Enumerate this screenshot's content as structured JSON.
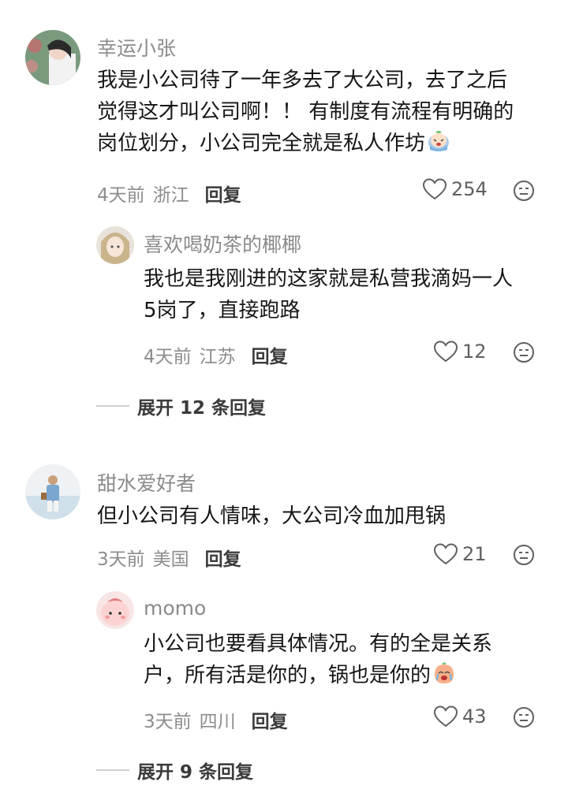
{
  "comments": [
    {
      "username": "幸运小张",
      "lines": [
        "我是小公司待了一年多去了大公司，去了之后",
        "觉得这才叫公司啊！！ 有制度有流程有明确的",
        "岗位划分，小公司完全就是私人作坊"
      ],
      "emoji": "crying-emoji",
      "time": "4天前",
      "location": "浙江",
      "reply_label": "回复",
      "likes": "254",
      "replies": [
        {
          "username": "喜欢喝奶茶的椰椰",
          "lines": [
            "我也是我刚进的这家就是私营我滴妈一人",
            "5岗了，直接跑路"
          ],
          "time": "4天前",
          "location": "江苏",
          "reply_label": "回复",
          "likes": "12"
        }
      ],
      "expand_label": "展开 12 条回复"
    },
    {
      "username": "甜水爱好者",
      "lines": [
        "但小公司有人情味，大公司冷血加甩锅"
      ],
      "time": "3天前",
      "location": "美国",
      "reply_label": "回复",
      "likes": "21",
      "replies": [
        {
          "username": "momo",
          "lines": [
            "小公司也要看具体情况。有的全是关系",
            "户，所有活是你的，锅也是你的"
          ],
          "emoji": "sobbing-peach-emoji",
          "time": "3天前",
          "location": "四川",
          "reply_label": "回复",
          "likes": "43"
        }
      ],
      "expand_label": "展开 9 条回复"
    }
  ],
  "colors": {
    "username": "#8b8b8b",
    "text": "#161616",
    "meta": "#8d8d8d",
    "icon": "#5f5f5f"
  }
}
